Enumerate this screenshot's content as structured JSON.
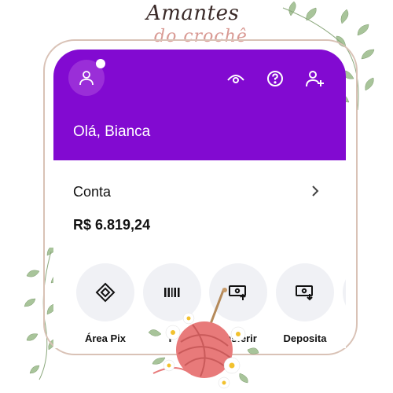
{
  "watermark": {
    "line1": "Amantes",
    "line2": "do crochê"
  },
  "header": {
    "greeting": "Olá, Bianca",
    "icons": [
      "profile-icon",
      "eye-icon",
      "help-icon",
      "add-user-icon"
    ]
  },
  "account": {
    "label": "Conta",
    "balance": "R$ 6.819,24"
  },
  "actions": [
    {
      "label": "Área Pix",
      "icon": "pix-icon"
    },
    {
      "label": "P",
      "icon": "barcode-icon"
    },
    {
      "label": "ansferir",
      "icon": "transfer-icon"
    },
    {
      "label": "Deposita",
      "icon": "deposit-icon"
    }
  ],
  "colors": {
    "brand": "#820ad1",
    "action_bg": "#f0f1f5",
    "frame": "#d9c2b6"
  }
}
